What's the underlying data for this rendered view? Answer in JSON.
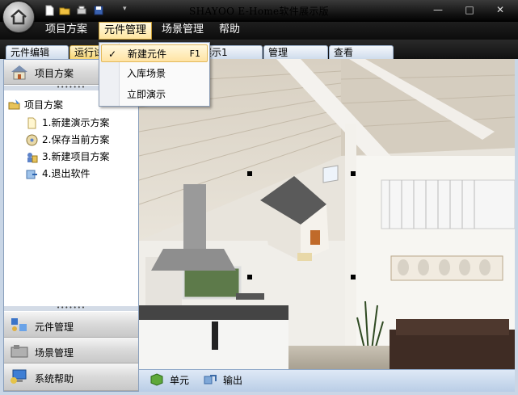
{
  "window": {
    "title": "SHAYOO E-Home软件展示版",
    "minimize": "—",
    "restore": "□",
    "close": "✕"
  },
  "quick_access": [
    "new-file-icon",
    "open-folder-icon",
    "print-icon",
    "save-icon",
    "dropdown-arrow-icon"
  ],
  "menubar": {
    "items": [
      "项目方案",
      "元件管理",
      "场景管理",
      "帮助"
    ],
    "active": "元件管理"
  },
  "tabs": {
    "items": [
      "元件编辑",
      "运行试",
      "展示1",
      "管理",
      "查看"
    ],
    "active": "运行试"
  },
  "dropdown": {
    "items": [
      {
        "label": "新建元件",
        "shortcut": "F1",
        "checked": true
      },
      {
        "label": "入库场景"
      },
      {
        "label": "立即演示"
      }
    ]
  },
  "left_panel": {
    "header": "项目方案",
    "tree_root": "项目方案",
    "tree_items": [
      "1.新建演示方案",
      "2.保存当前方案",
      "3.新建项目方案",
      "4.退出软件"
    ],
    "nav_buttons": [
      "元件管理",
      "场景管理",
      "系统帮助"
    ],
    "grip": "•••••••"
  },
  "bottom_toolbar": {
    "items": [
      "单元",
      "输出"
    ]
  },
  "colors": {
    "accent": "#ffe3a3",
    "titlebar": "#151515",
    "panel_border": "#8ba0bc"
  }
}
